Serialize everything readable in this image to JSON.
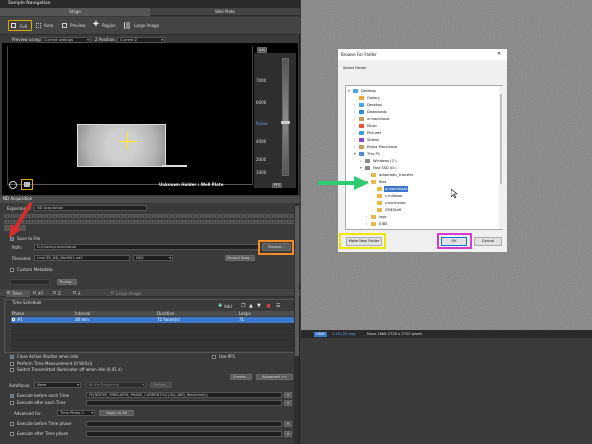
{
  "panel": {
    "title": "Sample Navigation",
    "tab_stage": "Stage",
    "tab_wellplate": "Well Plate"
  },
  "toolbar": {
    "full": "Full",
    "area": "Area",
    "preview": "Preview",
    "region": "Region",
    "large_image": "Large Image"
  },
  "preview": {
    "using_label": "Preview using:",
    "using_value": "Current settings",
    "zpos_label": "Z Position:",
    "zpos_value": "Current Z"
  },
  "saturation": {
    "set_label": "Set",
    "ticks": [
      "7000",
      "6000",
      "Focus",
      "4000",
      "2000",
      "1000"
    ],
    "btn": "PFS"
  },
  "view": {
    "holder_label": "Unknown Holder : Well Plate"
  },
  "nd": {
    "title": "ND Acquisition",
    "experiment_label": "Experiment:",
    "experiment_value": "ND Acquisition",
    "save_label": "Save to File",
    "path_label": "Path:",
    "path_value": "D:\\Users\\a.macickova",
    "browse": "Browse...",
    "filename_label": "Filename:",
    "filename_value": "LiveCEll_ND_Well001.nd2",
    "nd_value": "ND2",
    "record_data": "Record Data...",
    "custom_metadata": "Custom Metadata",
    "timing": "Timing..."
  },
  "tabs": {
    "time": "Time",
    "xy": "XY",
    "z": "Z",
    "lambda": "λ",
    "large_image": "Large Image"
  },
  "schedule": {
    "title": "Time Schedule",
    "add": "Add",
    "headers": [
      "Phase",
      "Interval",
      "Duration",
      "Loops"
    ],
    "row": {
      "phase": "#1",
      "interval": "30 min",
      "duration": "72 hours(s)",
      "loops": "71"
    }
  },
  "options": {
    "close_shutter": "Close Active Shutter when idle",
    "use_pfs": "Use PFS",
    "perform_measurement": "Perform Time Measurement (0 W(0s))",
    "switch_illuminator": "Switch Transmitted Illuminator off when idle (0.01 s)",
    "events": "Events...",
    "advanced": "Advanced <<"
  },
  "autofocus": {
    "label": "Autofocus:",
    "value": "None",
    "at_beginning": "At the Beginning",
    "define": "Define..."
  },
  "advanced_rows": {
    "before_each": "Execute before each Time",
    "macro": "FE[NDEXP_TIMELAPSE_PHASE_CURRENT%2] Zip_NIID_Replenish();",
    "after_each": "Execute after each Time",
    "advanced_for": "Advanced for:",
    "phase_select": "Time Phase 1",
    "apply_all": "Apply to All",
    "before_phase": "Execute before Time phase",
    "after_phase": "Execute after Time phase"
  },
  "dialog": {
    "title": "Browse For Folder",
    "prompt": "Select Folder",
    "close": "✕",
    "make_new": "Make New Folder",
    "ok": "OK",
    "cancel": "Cancel",
    "items": [
      {
        "label": "Desktop",
        "indent": 0,
        "arrow": "▾",
        "type": "desktop"
      },
      {
        "label": "Gallery",
        "indent": 1,
        "arrow": "",
        "type": "gallery"
      },
      {
        "label": "Desktop",
        "indent": 1,
        "arrow": "›",
        "type": "folder-blue"
      },
      {
        "label": "Downloads",
        "indent": 1,
        "arrow": "›",
        "type": "download"
      },
      {
        "label": "a.macickova",
        "indent": 1,
        "arrow": "›",
        "type": "user"
      },
      {
        "label": "Music",
        "indent": 1,
        "arrow": "›",
        "type": "music"
      },
      {
        "label": "Pictures",
        "indent": 1,
        "arrow": "›",
        "type": "pictures"
      },
      {
        "label": "Videos",
        "indent": 1,
        "arrow": "›",
        "type": "videos"
      },
      {
        "label": "Eliska Macickova",
        "indent": 1,
        "arrow": "›",
        "type": "user"
      },
      {
        "label": "This PC",
        "indent": 1,
        "arrow": "▾",
        "type": "pc"
      },
      {
        "label": "Windows (C:)",
        "indent": 2,
        "arrow": "›",
        "type": "drive"
      },
      {
        "label": "Fast SSD (D:)",
        "indent": 2,
        "arrow": "▾",
        "type": "drive"
      },
      {
        "label": "automatic_transfer",
        "indent": 3,
        "arrow": "",
        "type": "folder"
      },
      {
        "label": "files",
        "indent": 3,
        "arrow": "▾",
        "type": "folder"
      },
      {
        "label": "a.macickova",
        "indent": 4,
        "arrow": "",
        "type": "folder",
        "selected": true
      },
      {
        "label": "c.miduser",
        "indent": 4,
        "arrow": "",
        "type": "folder"
      },
      {
        "label": "z.svcmauto",
        "indent": 4,
        "arrow": "",
        "type": "folder"
      },
      {
        "label": "ZMEStaff",
        "indent": 4,
        "arrow": "",
        "type": "folder"
      },
      {
        "label": "logs",
        "indent": 3,
        "arrow": "›",
        "type": "folder"
      },
      {
        "label": "JOBS",
        "indent": 3,
        "arrow": "›",
        "type": "folder"
      }
    ]
  },
  "status": {
    "badge": "GRAY",
    "zoom": "1:16 [20 ms]",
    "info": "None  16bit  2720 x 2720 pixels"
  },
  "colors": {
    "highlight_red": "#d32f2f",
    "highlight_orange": "#f28c28",
    "highlight_green": "#2ecc71",
    "highlight_yellow": "#f2e600",
    "highlight_magenta": "#d63ad1",
    "selection": "#3d77c9"
  }
}
